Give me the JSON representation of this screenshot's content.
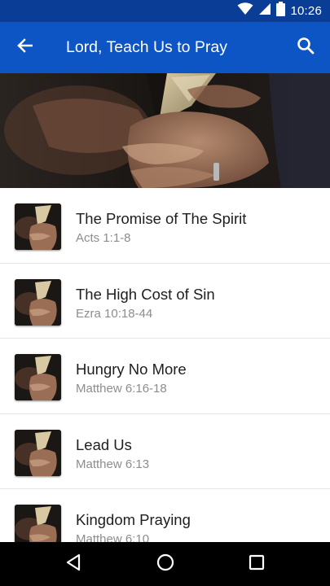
{
  "status_bar": {
    "time": "10:26"
  },
  "app_bar": {
    "title": "Lord, Teach Us to Pray"
  },
  "items": [
    {
      "title": "The Promise of The Spirit",
      "reference": "Acts 1:1-8"
    },
    {
      "title": "The High Cost of Sin",
      "reference": "Ezra 10:18-44"
    },
    {
      "title": "Hungry No More",
      "reference": "Matthew 6:16-18"
    },
    {
      "title": "Lead Us",
      "reference": "Matthew 6:13"
    },
    {
      "title": "Kingdom Praying",
      "reference": "Matthew 6:10"
    }
  ],
  "colors": {
    "status_bar": "#0a3e96",
    "app_bar": "#0d54c4",
    "nav_bar": "#000000"
  },
  "icons": [
    "wifi-icon",
    "cell-signal-icon",
    "battery-icon",
    "back-arrow-icon",
    "search-icon",
    "nav-back-icon",
    "nav-home-icon",
    "nav-recents-icon"
  ]
}
